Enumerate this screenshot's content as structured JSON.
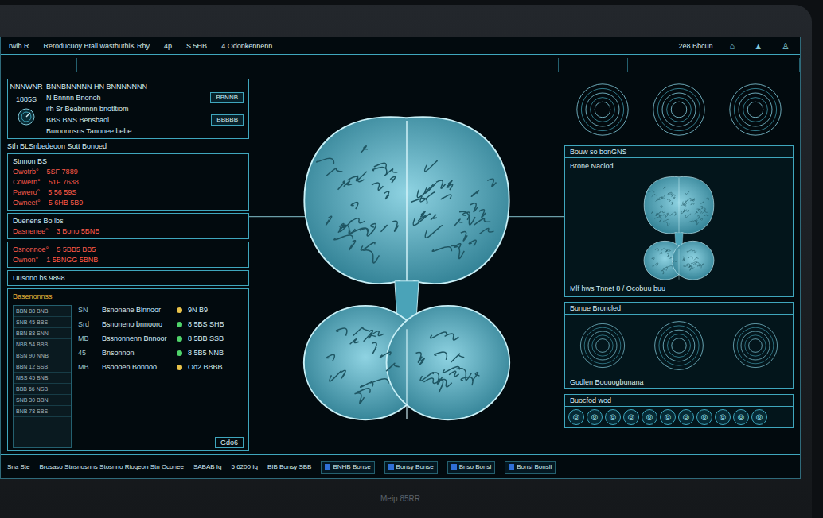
{
  "top_bar": {
    "items": [
      "rwih R",
      "Reroducuoy Btall wasthuthiK Rhy",
      "4p",
      "S 5HB",
      "4 Odonkennenn",
      "2e8 Bbcun"
    ],
    "icons": [
      "⌂",
      "▲",
      "♙"
    ]
  },
  "info_block": {
    "label": "NNNWNR",
    "code": "1885S",
    "lines": [
      {
        "text": "BNNBNNNNN HN BNNNNNNN",
        "button": ""
      },
      {
        "text": "N Bnnnn Bnonoh",
        "button": "BBNNB"
      },
      {
        "text": "ifh Sr Beabrinnn bnotltiom",
        "button": ""
      },
      {
        "text": "BBS BNS Bensbaol",
        "button": "BBBBB"
      },
      {
        "text": "Buroonnsns Tanonee bebe",
        "button": ""
      }
    ]
  },
  "subtitle": "Sth BLSnbedeoon   Sott Bonoed",
  "readings": {
    "title": "Stnnon BS",
    "rows": [
      {
        "label": "Owotrb°",
        "value": "5SF 7889"
      },
      {
        "label": "Cowern°",
        "value": "51F 7638"
      },
      {
        "label": "Pawero°",
        "value": "5 56 59S"
      },
      {
        "label": "Owneet°",
        "value": "5 6HB 5B9"
      }
    ]
  },
  "stats_a": {
    "title": "Duenens Bo lbs",
    "rows": [
      {
        "label": "Dasnenee°",
        "value": "3 Bono 5BNB"
      }
    ]
  },
  "stats_b": {
    "rows": [
      {
        "label": "Osnonnoe°",
        "value": "5 5BB5 BB5"
      },
      {
        "label": "Ownon°",
        "value": "1 5BNGG 5BNB"
      }
    ]
  },
  "stats_c": {
    "title": "Uusono bs 9898"
  },
  "bottom_block": {
    "title": "Basenonnss",
    "grid_rows": [
      "BBN 88 BNB",
      "SNB 45 BBS",
      "BBN 88 SNN",
      "NBB 54 BBB",
      "BSN 90 NNB",
      "BBN 12 SSB",
      "NBS 45 BNB",
      "BBB 66 NSB",
      "SNB 30 BBN",
      "BNB 78 SBS"
    ],
    "entries": [
      {
        "tag": "SN",
        "label": "Bsnonane Blnnoor",
        "value": "9N B9",
        "color": "#e8c24a"
      },
      {
        "tag": "Srd",
        "label": "Bsnoneno bnnooro",
        "value": "8 5BS SHB",
        "color": "#4fd36a"
      },
      {
        "tag": "MB",
        "label": "Bssnonnenn Bnnoor",
        "value": "8 5BB SSB",
        "color": "#4fd36a"
      },
      {
        "tag": "45",
        "label": "Bnsonnon",
        "value": "8 5B5 NNB",
        "color": "#4fd36a"
      },
      {
        "tag": "MB",
        "label": "Bsoooen Bonnoo",
        "value": "Oo2 BBBB",
        "color": "#e8c24a"
      }
    ],
    "footer": "Gdo6"
  },
  "scan_card": {
    "header": "Bouw so bonGNS",
    "title": "Brone Naclod",
    "caption": "Mlf hws Tnnet 8 / Ocobuu buu"
  },
  "detail_card": {
    "title": "Bunue Broncled",
    "footer": "Gudlen Bouuogbunana"
  },
  "toolbar": {
    "title": "Buocfod wod",
    "buttons": [
      "◎",
      "◎",
      "◎",
      "◎",
      "◎",
      "◎",
      "◎",
      "◎",
      "◎",
      "◎",
      "◎"
    ]
  },
  "status_bar": {
    "items": [
      {
        "text": "Sna Ste",
        "kind": "text"
      },
      {
        "text": "Brosaso Stnsnosnns Stosnno Rioqeon Stn Oconee",
        "kind": "text"
      },
      {
        "text": "SABAB Iq",
        "kind": "text"
      },
      {
        "text": "5 6200 Iq",
        "kind": "text"
      },
      {
        "text": "BIB Bonsy SBB",
        "kind": "text"
      },
      {
        "text": "BNHB Bonse",
        "kind": "button"
      },
      {
        "text": "Bonsy Bonse",
        "kind": "button"
      },
      {
        "text": "Bnso Bonsl",
        "kind": "button"
      },
      {
        "text": "Bonsl Bonsll",
        "kind": "button"
      }
    ]
  },
  "bezel_label": "Meip 85RR"
}
